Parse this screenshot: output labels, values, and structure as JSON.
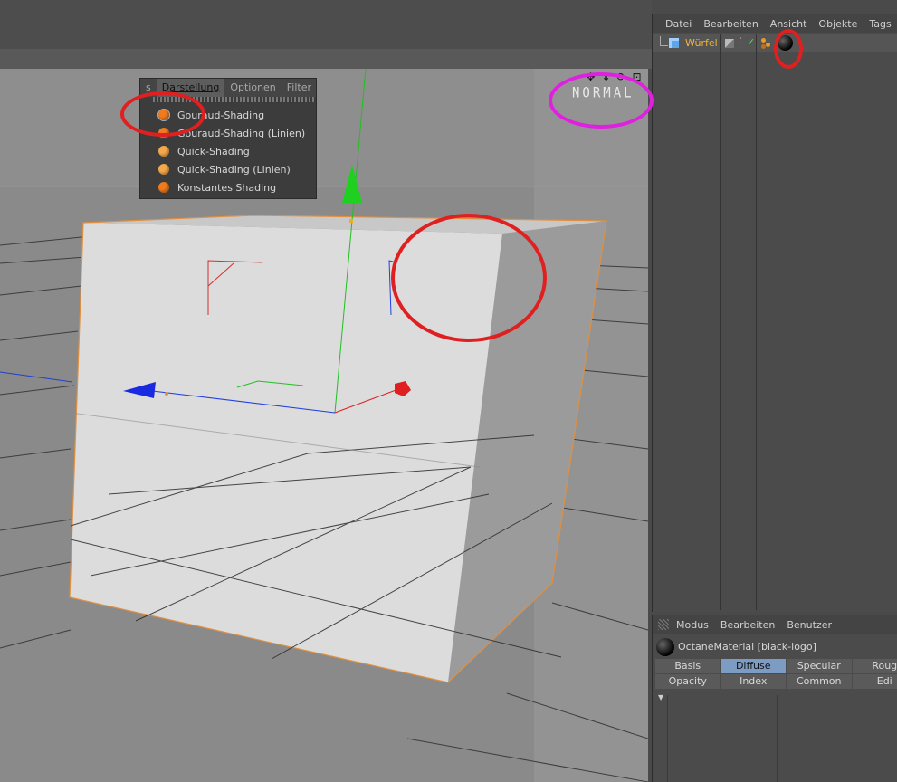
{
  "viewport": {
    "shading_label": "NORMAL",
    "nav_icons": [
      "move-icon",
      "zoom-icon",
      "rotate-icon",
      "maximize-icon"
    ]
  },
  "display_menu": {
    "tabs": [
      "s",
      "Darstellung",
      "Optionen",
      "Filter"
    ],
    "active_tab": "Darstellung",
    "items": [
      "Gouraud-Shading",
      "Gouraud-Shading (Linien)",
      "Quick-Shading",
      "Quick-Shading (Linien)",
      "Konstantes Shading"
    ],
    "selected_item": "Gouraud-Shading"
  },
  "object_manager": {
    "menu": [
      "Datei",
      "Bearbeiten",
      "Ansicht",
      "Objekte",
      "Tags"
    ],
    "object_name": "Würfel"
  },
  "attribute_manager": {
    "menu": [
      "Modus",
      "Bearbeiten",
      "Benutzer"
    ],
    "material_title": "OctaneMaterial [black-logo]",
    "tabs_row1": [
      "Basis",
      "Diffuse",
      "Specular",
      "Roug"
    ],
    "tabs_row2": [
      "Opacity",
      "Index",
      "Common",
      "Edi"
    ],
    "active_tab": "Diffuse"
  },
  "colors": {
    "accent_orange": "#f07a1c",
    "annotation_red": "#e02020",
    "annotation_magenta": "#e020e0",
    "object_name": "#f0b43a",
    "tab_active": "#7d9cc4"
  }
}
